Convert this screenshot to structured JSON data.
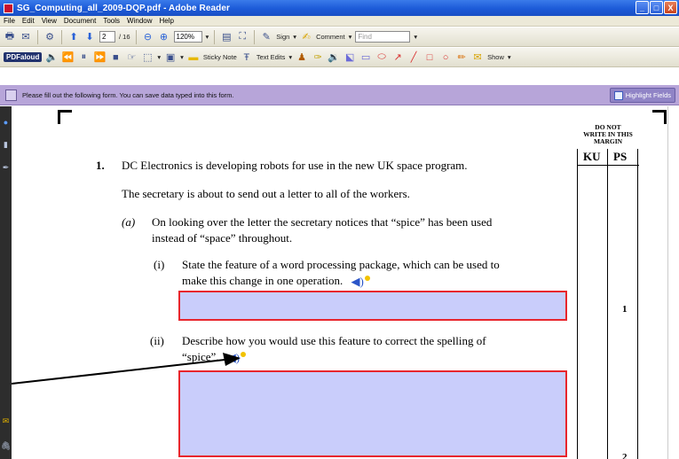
{
  "window": {
    "title": "SG_Computing_all_2009-DQP.pdf - Adobe Reader",
    "controls": [
      "_",
      "□",
      "X"
    ]
  },
  "menu": [
    "File",
    "Edit",
    "View",
    "Document",
    "Tools",
    "Window",
    "Help"
  ],
  "toolbar1": {
    "page_current": "2",
    "page_total": "/ 16",
    "zoom": "120%",
    "sign_label": "Sign",
    "comment_label": "Comment",
    "find_placeholder": "Find"
  },
  "toolbar2": {
    "pdfaloud_label": "PDFaloud",
    "sticky_note_label": "Sticky Note",
    "text_edits_label": "Text Edits",
    "show_label": "Show"
  },
  "form_bar": {
    "message": "Please fill out the following form. You can save data typed into this form.",
    "highlight_label": "Highlight Fields"
  },
  "document": {
    "margin_note": "DO NOT WRITE IN THIS MARGIN",
    "col_ku": "KU",
    "col_ps": "PS",
    "q_number": "1.",
    "q_intro": "DC Electronics is developing robots for use in the new UK space program.",
    "q_context": "The secretary is about to send out a letter to all of the workers.",
    "part_a_label": "(a)",
    "part_a_text_1": "On looking over the letter the secretary notices that “spice” has been used",
    "part_a_text_2": "instead of “space” throughout.",
    "part_i_label": "(i)",
    "part_i_text_1": "State the feature of a word processing package, which can be used to",
    "part_i_text_2": "make this change in one operation.",
    "part_i_mark": "1",
    "part_ii_label": "(ii)",
    "part_ii_text_1": "Describe how you would use this feature to correct the spelling of",
    "part_ii_text_2": "“spice”.",
    "part_ii_mark": "2"
  },
  "colors": {
    "field_fill": "#c9cdfb",
    "field_border": "#e8262d",
    "form_bar": "#b7a5d9",
    "title_bar": "#1c5ad8"
  }
}
